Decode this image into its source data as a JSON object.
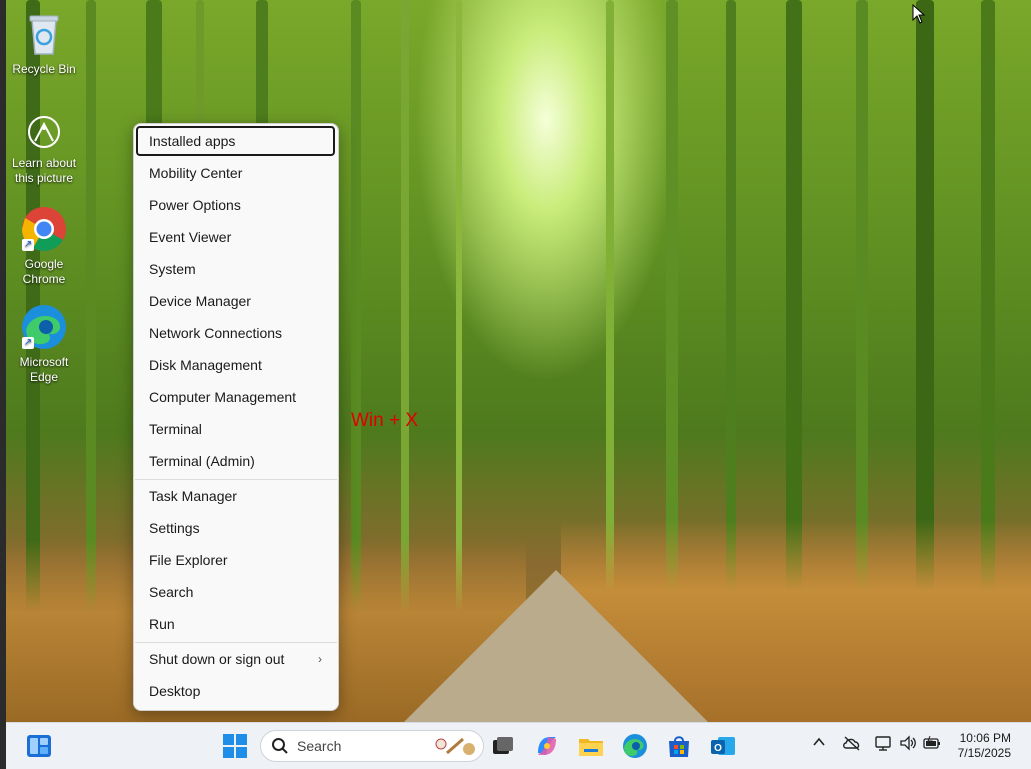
{
  "desktop": {
    "icons": [
      {
        "label": "Recycle Bin",
        "icon": "recycle-bin-icon"
      },
      {
        "label": "Learn about this picture",
        "icon": "learn-about-picture-icon"
      },
      {
        "label": "Google Chrome",
        "icon": "chrome-icon"
      },
      {
        "label": "Microsoft Edge",
        "icon": "edge-icon"
      }
    ],
    "overlay_label": "Win + X"
  },
  "context_menu": {
    "items": [
      {
        "label": "Installed apps",
        "focused": true
      },
      {
        "label": "Mobility Center"
      },
      {
        "label": "Power Options"
      },
      {
        "label": "Event Viewer"
      },
      {
        "label": "System"
      },
      {
        "label": "Device Manager"
      },
      {
        "label": "Network Connections"
      },
      {
        "label": "Disk Management"
      },
      {
        "label": "Computer Management"
      },
      {
        "label": "Terminal"
      },
      {
        "label": "Terminal (Admin)"
      },
      {
        "label": "Task Manager"
      },
      {
        "label": "Settings"
      },
      {
        "label": "File Explorer"
      },
      {
        "label": "Search"
      },
      {
        "label": "Run"
      },
      {
        "label": "Shut down or sign out",
        "has_submenu": true
      },
      {
        "label": "Desktop"
      }
    ],
    "submenu_arrow": "›"
  },
  "taskbar": {
    "search_placeholder": "Search",
    "apps": [
      "widgets-icon",
      "start-icon",
      "task-view-icon",
      "copilot-icon",
      "file-explorer-icon",
      "edge-icon",
      "store-icon",
      "outlook-icon"
    ],
    "tray": {
      "chevron": "^",
      "icons": [
        "onedrive-icon",
        "network-icon",
        "volume-icon",
        "battery-icon"
      ]
    },
    "clock": {
      "time": "10:06 PM",
      "date": "7/15/2025"
    }
  },
  "colors": {
    "accent": "#0067c0",
    "overlay_text": "#e00000",
    "menu_bg": "#f9f9f9",
    "taskbar_bg": "#eef1f5"
  }
}
